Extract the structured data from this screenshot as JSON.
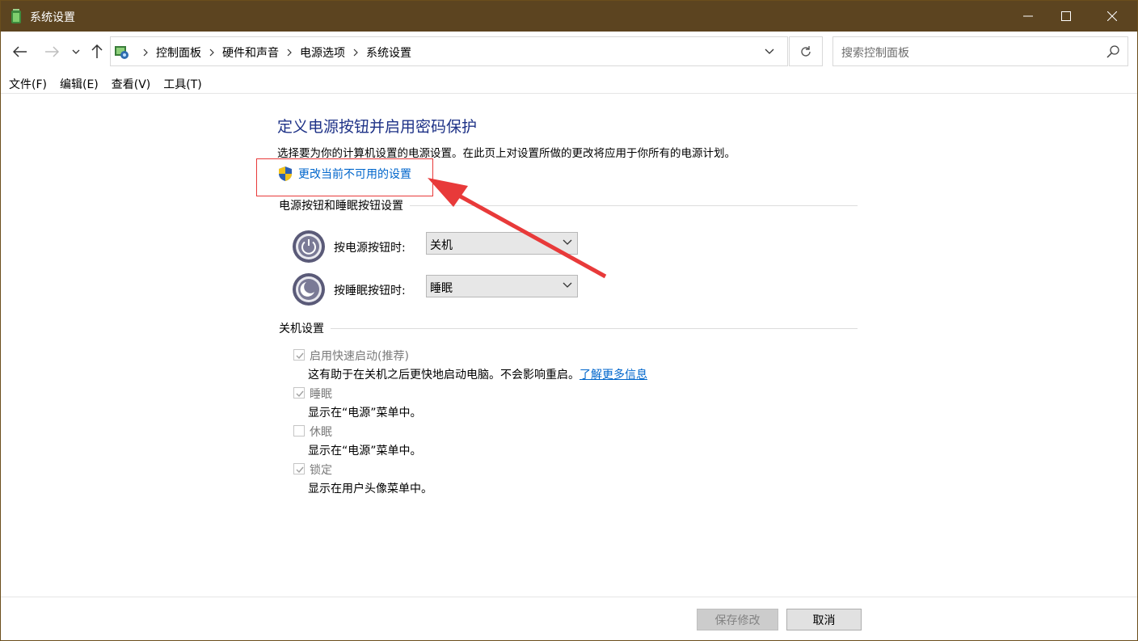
{
  "window": {
    "title": "系统设置"
  },
  "nav": {
    "breadcrumbs": [
      "控制面板",
      "硬件和声音",
      "电源选项",
      "系统设置"
    ],
    "search_placeholder": "搜索控制面板"
  },
  "menu": {
    "items": [
      "文件(F)",
      "编辑(E)",
      "查看(V)",
      "工具(T)"
    ]
  },
  "main": {
    "heading": "定义电源按钮并启用密码保护",
    "description": "选择要为你的计算机设置的电源设置。在此页上对设置所做的更改将应用于你所有的电源计划。",
    "change_link": "更改当前不可用的设置",
    "power_section": {
      "title": "电源按钮和睡眠按钮设置",
      "power_label": "按电源按钮时:",
      "power_value": "关机",
      "sleep_label": "按睡眠按钮时:",
      "sleep_value": "睡眠"
    },
    "shutdown_section": {
      "title": "关机设置",
      "options": [
        {
          "label": "启用快速启动(推荐)",
          "checked": true,
          "desc": "这有助于在关机之后更快地启动电脑。不会影响重启。",
          "link": "了解更多信息"
        },
        {
          "label": "睡眠",
          "checked": true,
          "desc": "显示在“电源”菜单中。"
        },
        {
          "label": "休眠",
          "checked": false,
          "desc": "显示在“电源”菜单中。"
        },
        {
          "label": "锁定",
          "checked": true,
          "desc": "显示在用户头像菜单中。"
        }
      ]
    }
  },
  "footer": {
    "save_label": "保存修改",
    "cancel_label": "取消"
  },
  "colors": {
    "titlebar": "#5c4420",
    "heading": "#1e3287",
    "link": "#0066cc",
    "annotation": "#e83a3a"
  }
}
